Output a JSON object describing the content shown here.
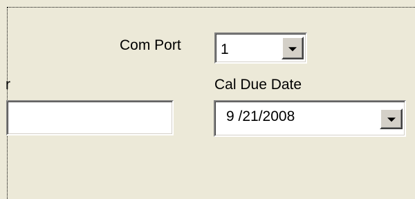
{
  "com_port": {
    "label": "Com Port",
    "value": "1"
  },
  "clipped_field": {
    "label_fragment": "r",
    "value": ""
  },
  "cal_due_date": {
    "label": "Cal Due Date",
    "value": "9 /21/2008"
  },
  "icons": {
    "dropdown_arrow": "chevron-down-icon"
  },
  "colors": {
    "window_background": "#ece9d8",
    "field_background": "#ffffff",
    "button_face": "#d4d0c8"
  }
}
